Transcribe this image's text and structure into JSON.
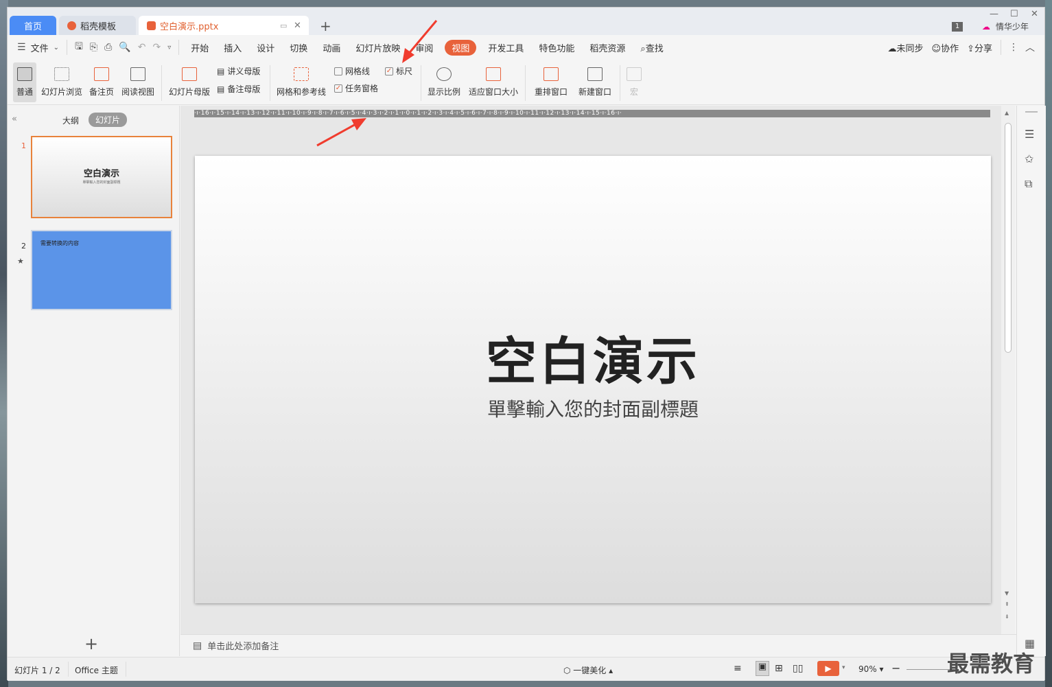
{
  "tabs": {
    "home": "首页",
    "daoke": "稻壳模板",
    "file": "空白演示.pptx"
  },
  "window": {
    "badge": "1",
    "user": "情华少年"
  },
  "menu": {
    "file": "文件",
    "items": [
      "开始",
      "插入",
      "设计",
      "切换",
      "动画",
      "幻灯片放映",
      "审阅",
      "视图",
      "开发工具",
      "特色功能",
      "稻壳资源"
    ],
    "active": "视图",
    "search": "查找",
    "sync": "未同步",
    "collab": "协作",
    "share": "分享"
  },
  "ribbon": {
    "normal": "普通",
    "slide_browse": "幻灯片浏览",
    "notes_page": "备注页",
    "read_view": "阅读视图",
    "slide_master": "幻灯片母版",
    "handout_master": "讲义母版",
    "notes_master": "备注母版",
    "grid_guides": "网格和参考线",
    "gridlines": "网格线",
    "ruler": "标尺",
    "task_pane": "任务窗格",
    "zoom": "显示比例",
    "fit_window": "适应窗口大小",
    "arrange": "重排窗口",
    "new_window": "新建窗口",
    "macro": "宏"
  },
  "left": {
    "outline": "大纲",
    "slides": "幻灯片"
  },
  "thumbs": [
    {
      "num": "1",
      "title": "空白演示",
      "sub": "單擊輸入您的封面副標題"
    },
    {
      "num": "2",
      "title": "需要转换的内容"
    }
  ],
  "ruler_text": "·ı·16·ı·15·ı·14·ı·13·ı·12·ı·11·ı·10·ı·9·ı·8·ı·7·ı·6·ı·5·ı·4·ı·3·ı·2·ı·1·ı·0·ı·1·ı·2·ı·3·ı·4·ı·5·ı·6·ı·7·ı·8·ı·9·ı·10·ı·11·ı·12·ı·13·ı·14·ı·15·ı·16·ı·",
  "slide": {
    "title": "空白演示",
    "subtitle": "單擊輸入您的封面副標題"
  },
  "notes": "单击此处添加备注",
  "status": {
    "slide_count": "幻灯片 1 / 2",
    "theme": "Office 主题",
    "beautify": "一键美化",
    "zoom": "90%"
  },
  "watermark": "最需教育",
  "colors": {
    "accent": "#e8623b",
    "tab_blue": "#4b8cf5",
    "slide2_bg": "#5b94e8"
  }
}
